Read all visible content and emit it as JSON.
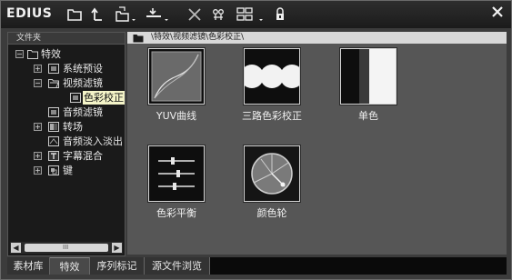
{
  "app": {
    "title": "EDIUS"
  },
  "toolbar": {
    "buttons": [
      {
        "name": "folder-icon"
      },
      {
        "name": "up-folder-icon"
      },
      {
        "name": "new-folder-icon"
      },
      {
        "name": "download-icon"
      },
      {
        "name": "delete-icon"
      },
      {
        "name": "properties-icon"
      },
      {
        "name": "view-mode-icon"
      },
      {
        "name": "lock-icon"
      }
    ],
    "close_icon": "close-icon"
  },
  "tree": {
    "header": "文件夹",
    "items": [
      {
        "label": "特效",
        "icon": "folder-icon",
        "expander": "−"
      },
      {
        "label": "系统预设",
        "icon": "effect-icon",
        "expander": "+"
      },
      {
        "label": "视频滤镜",
        "icon": "folder-open-icon",
        "expander": "−"
      },
      {
        "label": "色彩校正",
        "icon": "effect-icon",
        "selected": true
      },
      {
        "label": "音频滤镜",
        "icon": "effect-icon"
      },
      {
        "label": "转场",
        "icon": "transition-icon",
        "expander": "+"
      },
      {
        "label": "音频淡入淡出",
        "icon": "audio-fade-icon"
      },
      {
        "label": "字幕混合",
        "icon": "title-icon",
        "expander": "+"
      },
      {
        "label": "键",
        "icon": "key-icon",
        "expander": "+"
      }
    ],
    "scroll_grip": "III"
  },
  "content": {
    "path": "\\特效\\视频滤镜\\色彩校正\\",
    "items": [
      {
        "label": "YUV曲线",
        "icon": "yuv-curve-icon"
      },
      {
        "label": "三路色彩校正",
        "icon": "three-way-color-icon"
      },
      {
        "label": "单色",
        "icon": "monotone-icon"
      },
      {
        "label": "色彩平衡",
        "icon": "color-balance-icon"
      },
      {
        "label": "颜色轮",
        "icon": "color-wheel-icon"
      }
    ]
  },
  "tabs": [
    {
      "label": "素材库"
    },
    {
      "label": "特效",
      "active": true
    },
    {
      "label": "序列标记"
    },
    {
      "label": "源文件浏览"
    }
  ]
}
